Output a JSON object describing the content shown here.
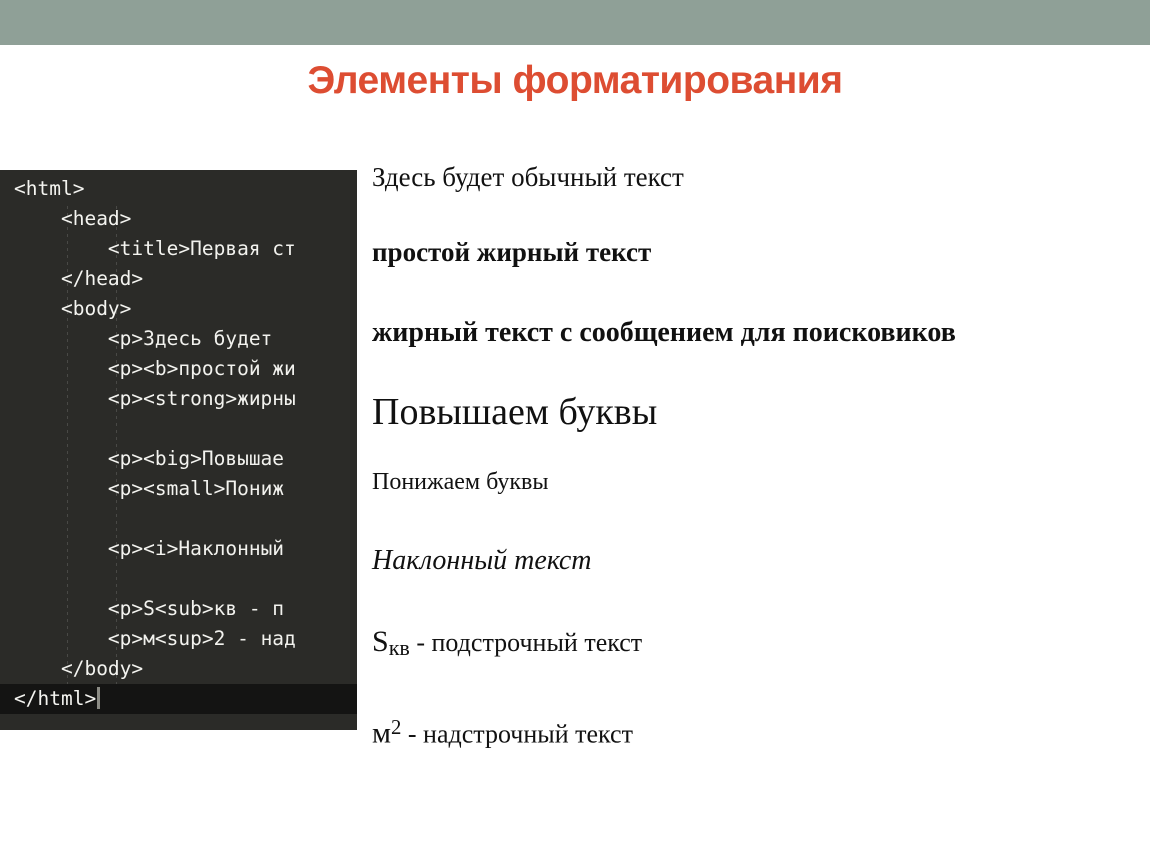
{
  "slide": {
    "title": "Элементы форматирования",
    "title_color": "#dd4d32",
    "band_color": "#8fa097",
    "background_color": "#ffffff"
  },
  "code_panel": {
    "background_color": "#2b2b28",
    "tag_color": "#e8336d",
    "bracket_color": "#f4f4f0",
    "text_color": "#f2f2ee",
    "lines": [
      {
        "brk_open": "<",
        "tag": "html",
        "brk_close": ">",
        "rest": ""
      },
      {
        "brk_open": "<",
        "tag": "head",
        "brk_close": ">",
        "rest": ""
      },
      {
        "brk_open": "<",
        "tag": "title",
        "brk_close": ">",
        "rest": "Первая ст"
      },
      {
        "brk_open": "</",
        "tag": "head",
        "brk_close": ">",
        "rest": ""
      },
      {
        "brk_open": "<",
        "tag": "body",
        "brk_close": ">",
        "rest": ""
      },
      {
        "brk_open": "<",
        "tag": "p",
        "brk_close": ">",
        "rest": "Здесь будет "
      },
      {
        "brk_open": "<",
        "tag": "p",
        "brk_close": ">",
        "tag2": "b",
        "rest": "простой жи"
      },
      {
        "brk_open": "<",
        "tag": "p",
        "brk_close": ">",
        "tag2": "strong",
        "rest": "жирны"
      },
      {
        "brk_open": "<",
        "tag": "p",
        "brk_close": ">",
        "tag2": "big",
        "rest": "Повышае"
      },
      {
        "brk_open": "<",
        "tag": "p",
        "brk_close": ">",
        "tag2": "small",
        "rest": "Пониж"
      },
      {
        "brk_open": "<",
        "tag": "p",
        "brk_close": ">",
        "tag2": "i",
        "rest": "Наклонный "
      },
      {
        "brk_open": "<",
        "tag": "p",
        "brk_close": ">",
        "mid": "S",
        "tag2": "sub",
        "rest": "кв - п"
      },
      {
        "brk_open": "<",
        "tag": "p",
        "brk_close": ">",
        "mid": "м",
        "tag2": "sup",
        "rest": "2 - над"
      },
      {
        "brk_open": "</",
        "tag": "body",
        "brk_close": ">",
        "rest": ""
      },
      {
        "brk_open": "</",
        "tag": "html",
        "brk_close": ">",
        "rest": ""
      }
    ],
    "line_text": {
      "html_open": "<html>",
      "head_open": "<head>",
      "title_open": "<title>",
      "title_content": "Первая ст",
      "head_close": "</head>",
      "body_open": "<body>",
      "p_open": "<p>",
      "p_content_1": "Здесь будет ",
      "b_open": "<b>",
      "b_content": "простой жи",
      "strong_open": "<strong>",
      "strong_content": "жирны",
      "big_open": "<big>",
      "big_content": "Повышае",
      "small_open": "<small>",
      "small_content": "Пониж",
      "i_open": "<i>",
      "i_content": "Наклонный ",
      "s_char": "S",
      "sub_open": "<sub>",
      "sub_content": "кв - п",
      "m_char": "м",
      "sup_open": "<sup>",
      "sup_content": "2 - над",
      "body_close": "</body>",
      "html_close": "</html>"
    }
  },
  "output": {
    "normal_text": "Здесь будет обычный текст",
    "bold_text": "простой жирный текст",
    "strong_text": "жирный текст с сообщением для поисковиков",
    "big_text": "Повышаем буквы",
    "small_text": "Понижаем буквы",
    "italic_text": "Наклонный текст",
    "sub_base": "S",
    "sub_script": "кв",
    "sub_tail": " - подстрочный текст",
    "sup_base": "м",
    "sup_script": "2",
    "sup_tail": " - надстрочный текст"
  }
}
